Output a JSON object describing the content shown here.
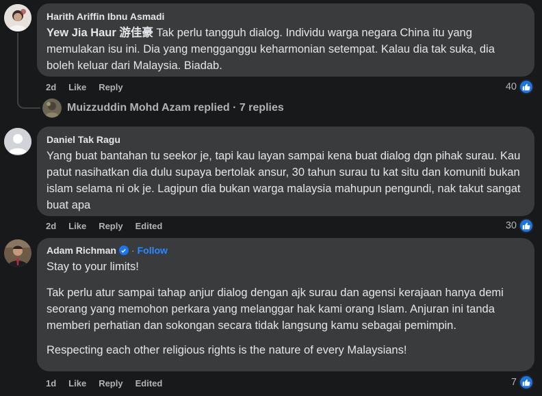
{
  "comments": [
    {
      "author": "Harith Ariffin Ibnu Asmadi",
      "mention": "Yew Jia Haur 游佳豪",
      "text": " Tak perlu tangguh dialog. Individu warga negara China itu yang memulakan isu ini. Dia yang mengganggu keharmonian setempat. Kalau dia tak suka, dia boleh keluar dari Malaysia. Biadab.",
      "time": "2d",
      "like": "Like",
      "reply": "Reply",
      "reactions": "40"
    },
    {
      "author": "Daniel Tak Ragu",
      "text": "Yang buat bantahan tu seekor je, tapi kau layan sampai kena buat dialog dgn pihak surau. Kau patut nasihatkan dia dulu supaya bertolak ansur, 30 tahun surau tu kat situ dan komuniti bukan islam selama ni ok je. Lagipun dia bukan warga malaysia mahupun pengundi, nak takut sangat buat apa",
      "time": "2d",
      "like": "Like",
      "reply": "Reply",
      "edited": "Edited",
      "reactions": "30"
    },
    {
      "author": "Adam Richman",
      "dot": "·",
      "follow": "Follow",
      "para1": "Stay to your limits!",
      "para2": "Tak perlu atur sampai tahap anjur dialog dengan ajk surau dan agensi kerajaan hanya demi seorang yang memohon perkara yang melanggar hak kami orang Islam. Anjuran ini tanda memberi perhatian dan sokongan secara tidak langsung kamu sebagai pemimpin.",
      "para3": "Respecting each other religious rights is the nature of every Malaysians!",
      "time": "1d",
      "like": "Like",
      "reply": "Reply",
      "edited": "Edited",
      "reactions": "7"
    }
  ],
  "replies_summary": "Muizzuddin Mohd Azam replied · 7 replies",
  "colors": {
    "background": "#18191a",
    "bubble": "#3a3b3c",
    "like_blue": "#1b74e4",
    "follow_blue": "#2d88ff"
  },
  "icons": [
    "avatar",
    "like-icon",
    "verified-icon"
  ]
}
